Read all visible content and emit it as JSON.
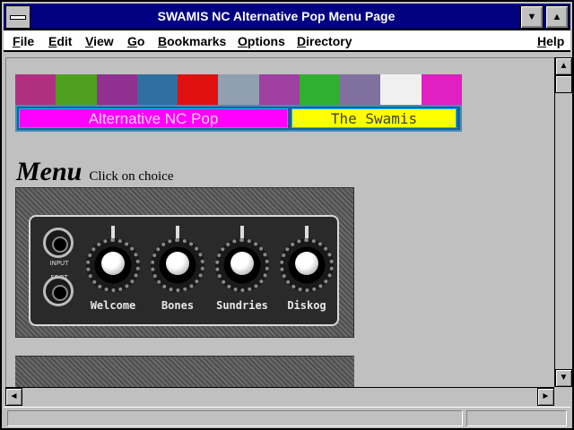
{
  "window": {
    "title": "SWAMIS NC Alternative Pop Menu Page"
  },
  "menubar": {
    "items": [
      {
        "label": "File"
      },
      {
        "label": "Edit"
      },
      {
        "label": "View"
      },
      {
        "label": "Go"
      },
      {
        "label": "Bookmarks"
      },
      {
        "label": "Options"
      },
      {
        "label": "Directory"
      },
      {
        "label": "Help"
      }
    ]
  },
  "page": {
    "banner": {
      "left_label": "Alternative NC Pop",
      "right_label": "The Swamis"
    },
    "heading": "Menu",
    "subheading": "Click on choice",
    "amp": {
      "jack_label": "INPUT\nFOOT\nSWITCH",
      "knobs": [
        {
          "label": "Welcome"
        },
        {
          "label": "Bones"
        },
        {
          "label": "Sundries"
        },
        {
          "label": "Diskog"
        }
      ]
    }
  },
  "colors": {
    "titlebar": "#000080",
    "banner_left": "#ff00ff",
    "banner_right": "#ffff00"
  },
  "icons": {
    "system_menu": "system-menu-icon",
    "minimize": "minimize-icon",
    "maximize": "maximize-icon",
    "scroll_up": "arrow-up-icon",
    "scroll_down": "arrow-down-icon",
    "scroll_left": "arrow-left-icon",
    "scroll_right": "arrow-right-icon"
  }
}
